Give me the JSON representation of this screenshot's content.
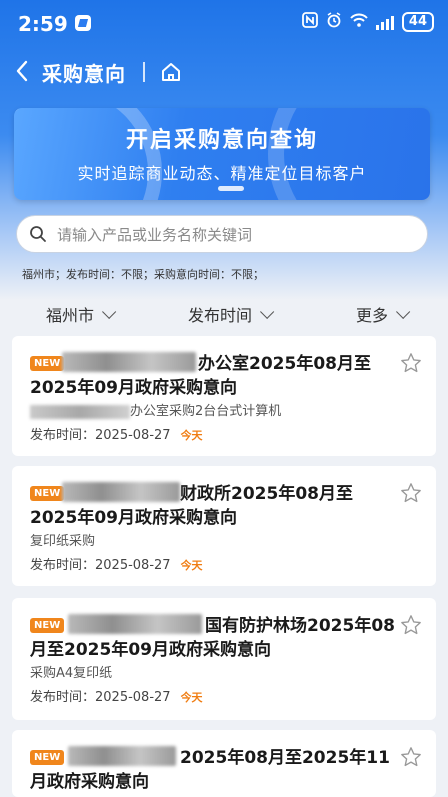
{
  "status_bar": {
    "time": "2:59",
    "battery": "44"
  },
  "nav": {
    "title": "采购意向"
  },
  "banner": {
    "title": "开启采购意向查询",
    "subtitle": "实时追踪商业动态、精准定位目标客户"
  },
  "search": {
    "placeholder": "请输入产品或业务名称关键词"
  },
  "filter_summary": "福州市；发布时间：不限；采购意向时间：不限；",
  "filters": [
    {
      "label": "福州市"
    },
    {
      "label": "发布时间"
    },
    {
      "label": "更多"
    }
  ],
  "cards": [
    {
      "badge": "NEW",
      "title": "办公室2025年08月至2025年09月政府采购意向",
      "subtitle": "办公室采购2台台式计算机",
      "date_label": "发布时间：2025-08-27",
      "today": "今天"
    },
    {
      "badge": "NEW",
      "title": "财政所2025年08月至2025年09月政府采购意向",
      "subtitle": "复印纸采购",
      "date_label": "发布时间：2025-08-27",
      "today": "今天"
    },
    {
      "badge": "NEW",
      "title": "国有防护林场2025年08月至2025年09月政府采购意向",
      "subtitle": "采购A4复印纸",
      "date_label": "发布时间：2025-08-27",
      "today": "今天"
    },
    {
      "badge": "NEW",
      "title": "2025年08月至2025年11月政府采购意向"
    }
  ]
}
